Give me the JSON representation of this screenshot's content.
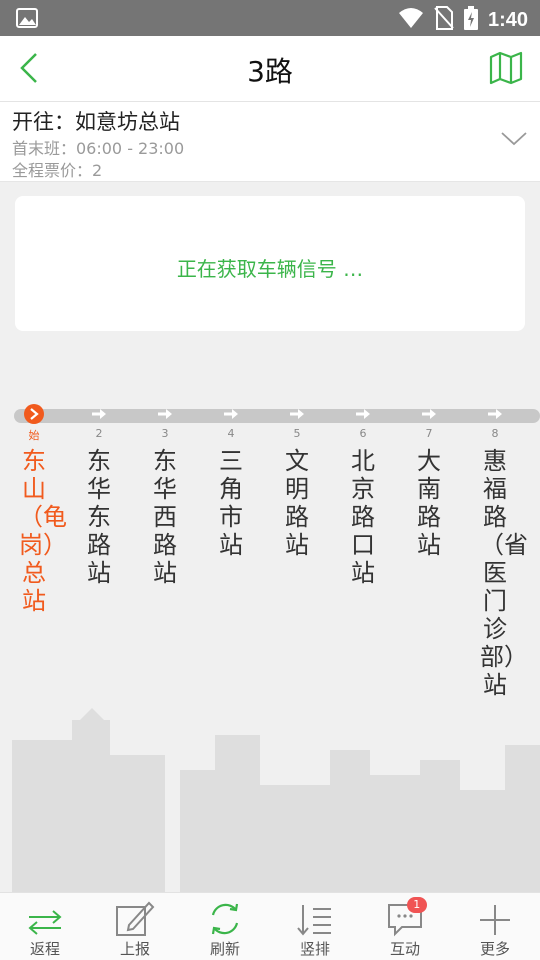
{
  "status_bar": {
    "time": "1:40"
  },
  "header": {
    "title": "3路"
  },
  "info": {
    "destination": "开往：如意坊总站",
    "hours": "首末班：06:00 - 23:00",
    "fare": "全程票价：2"
  },
  "signal_card": {
    "message": "正在获取车辆信号 …"
  },
  "stops": [
    {
      "num": "始",
      "name": "东山（龟岗）总站"
    },
    {
      "num": "2",
      "name": "东华东路站"
    },
    {
      "num": "3",
      "name": "东华西路站"
    },
    {
      "num": "4",
      "name": "三角市站"
    },
    {
      "num": "5",
      "name": "文明路站"
    },
    {
      "num": "6",
      "name": "北京路口站"
    },
    {
      "num": "7",
      "name": "大南路站"
    },
    {
      "num": "8",
      "name": "惠福路（省医门诊部）站"
    }
  ],
  "bottom_nav": [
    {
      "label": "返程",
      "icon": "swap-icon"
    },
    {
      "label": "上报",
      "icon": "edit-icon"
    },
    {
      "label": "刷新",
      "icon": "refresh-icon"
    },
    {
      "label": "竖排",
      "icon": "vertical-list-icon"
    },
    {
      "label": "互动",
      "icon": "chat-icon",
      "badge": "1"
    },
    {
      "label": "更多",
      "icon": "plus-icon"
    }
  ],
  "colors": {
    "accent_green": "#3bb54a",
    "origin_orange": "#f15a1d",
    "badge_red": "#f05454"
  }
}
